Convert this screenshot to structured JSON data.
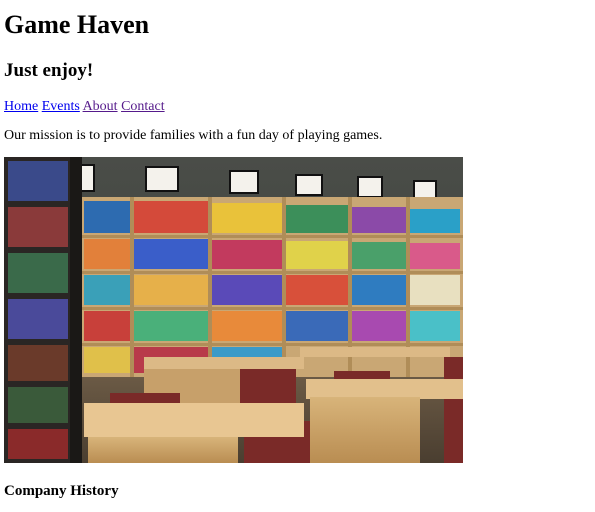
{
  "site": {
    "title": "Game Haven",
    "tagline": "Just enjoy!"
  },
  "nav": {
    "items": [
      {
        "label": "Home"
      },
      {
        "label": "Events"
      },
      {
        "label": "About"
      },
      {
        "label": "Contact"
      }
    ]
  },
  "main": {
    "mission": "Our mission is to provide families with a fun day of playing games.",
    "section_heading": "Company History"
  },
  "colors": {
    "link": "#0000ee",
    "visited_link": "#551a8b",
    "text": "#000000",
    "background": "#ffffff"
  }
}
